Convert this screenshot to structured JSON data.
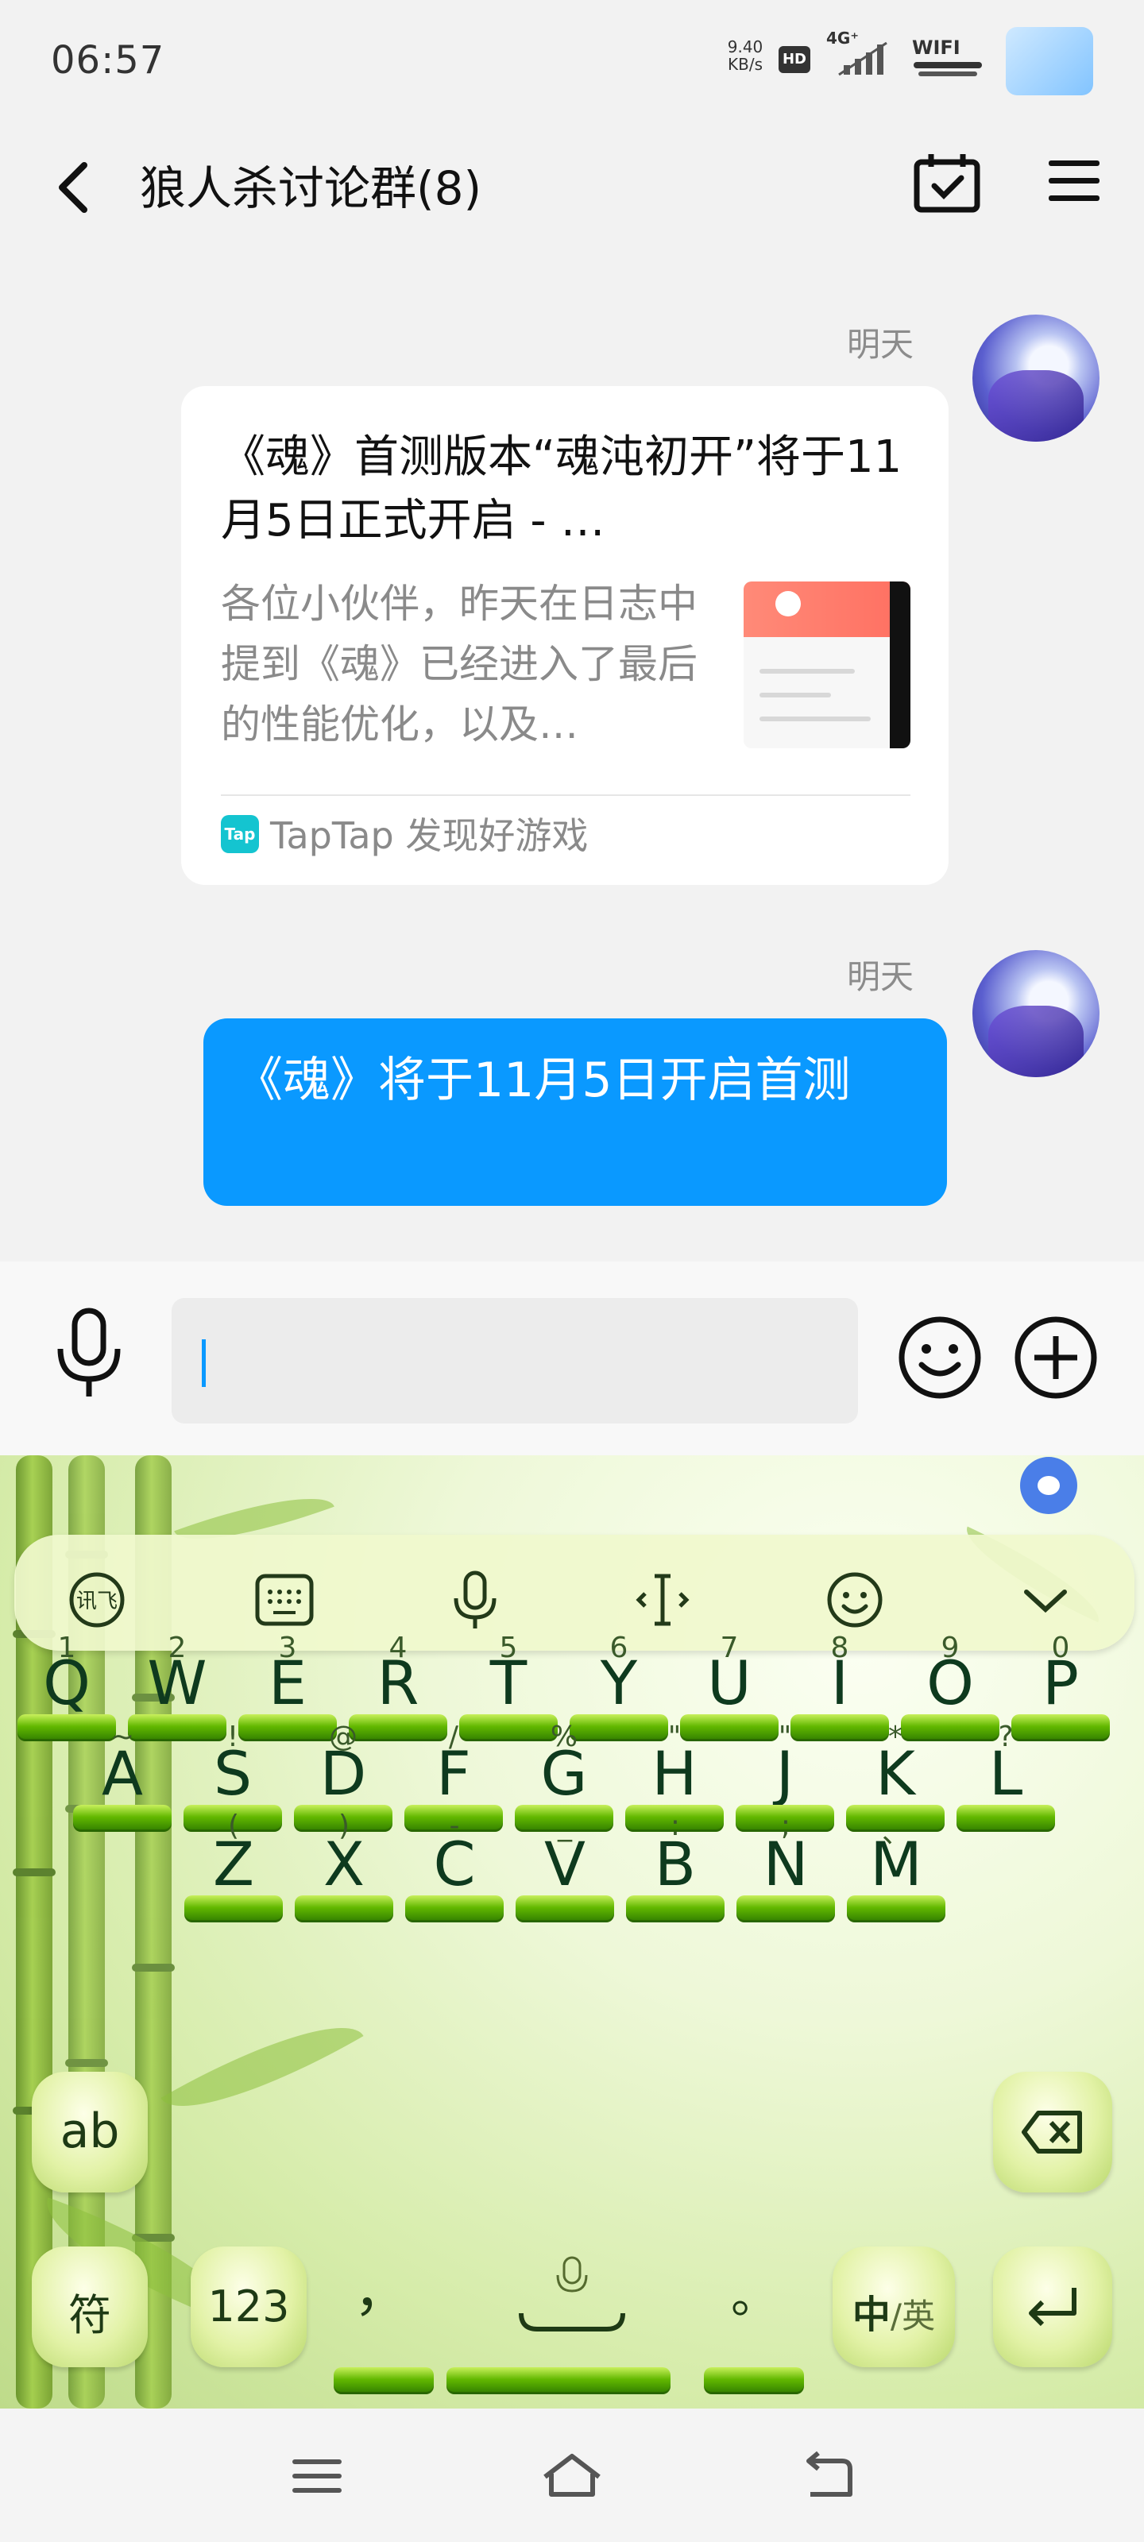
{
  "status": {
    "time": "06:57",
    "net_speed_value": "9.40",
    "net_speed_unit": "KB/s",
    "hd": "HD",
    "network": "4G⁺",
    "wifi": "WIFI"
  },
  "header": {
    "title": "狼人杀讨论群(8)",
    "back_icon": "chevron-left-icon",
    "calendar_icon": "calendar-check-icon",
    "menu_icon": "menu-icon"
  },
  "messages": [
    {
      "sender": "明天",
      "type": "link-card",
      "title": "《魂》首测版本“魂沌初开”将于11月5日正式开启 - …",
      "description": "各位小伙伴，昨天在日志中提到《魂》已经进入了最后的性能优化，以及…",
      "source": "TapTap 发现好游戏",
      "source_logo": "Tap"
    },
    {
      "sender": "明天",
      "type": "text",
      "text": "《魂》将于11月5日开启首测"
    }
  ],
  "input": {
    "placeholder": "",
    "value": ""
  },
  "keyboard": {
    "row1": {
      "keys": [
        "Q",
        "W",
        "E",
        "R",
        "T",
        "Y",
        "U",
        "I",
        "O",
        "P"
      ],
      "hints": [
        "1",
        "2",
        "3",
        "4",
        "5",
        "6",
        "7",
        "8",
        "9",
        "0"
      ]
    },
    "row2": {
      "keys": [
        "A",
        "S",
        "D",
        "F",
        "G",
        "H",
        "J",
        "K",
        "L"
      ],
      "hints": [
        "~",
        "!",
        "@",
        "/",
        "%",
        "\"",
        "\"",
        "*",
        "?"
      ]
    },
    "row3": {
      "keys": [
        "Z",
        "X",
        "C",
        "V",
        "B",
        "N",
        "M"
      ],
      "hints": [
        "(",
        ")",
        "-",
        "_",
        ":",
        ";",
        "、"
      ]
    },
    "ab_key": "ab",
    "symbol_key": "符",
    "num_key": "123",
    "comma_key": "，",
    "period_key": "。",
    "lang_key_main": "中",
    "lang_key_alt": "/英"
  }
}
